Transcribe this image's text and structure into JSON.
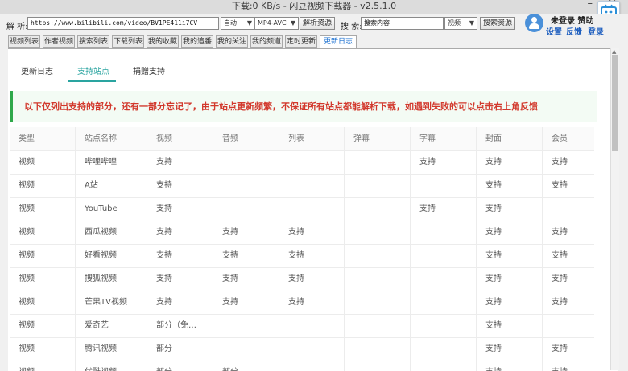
{
  "app": {
    "title": "下载:0 KB/s - 闪豆视频下载器 - v2.5.1.0",
    "minimize": "–",
    "close": "×"
  },
  "toolbar": {
    "parse_label": "解  析:",
    "url_value": "https://www.bilibili.com/video/BV1PE411i7CV",
    "quality_value": "自动",
    "format_value": "MP4-AVC",
    "parse_button": "解析资源",
    "search_label": "搜  索:",
    "search_value": "搜索内容",
    "search_type_value": "视频",
    "search_button": "搜索资源"
  },
  "user": {
    "status": "未登录 赞助",
    "settings": "设置",
    "feedback": "反馈",
    "login": "登录"
  },
  "tabs": [
    "视频列表",
    "作者视频",
    "搜索列表",
    "下载列表",
    "我的收藏",
    "我的追番",
    "我的关注",
    "我的频道",
    "定时更新",
    "更新日志"
  ],
  "subtabs": [
    "更新日志",
    "支持站点",
    "捐赠支持"
  ],
  "notice": "以下仅列出支持的部分，还有一部分忘记了，由于站点更新频繁，不保证所有站点都能解析下载，如遇到失败的可以点击右上角反馈",
  "table": {
    "columns": [
      "类型",
      "站点名称",
      "视频",
      "音频",
      "列表",
      "弹幕",
      "字幕",
      "封面",
      "会员"
    ],
    "rows": [
      [
        "视频",
        "哔哩哔哩",
        "支持",
        "",
        "",
        "",
        "支持",
        "支持",
        "支持"
      ],
      [
        "视频",
        "A站",
        "支持",
        "",
        "",
        "",
        "",
        "支持",
        "支持"
      ],
      [
        "视频",
        "YouTube",
        "支持",
        "",
        "",
        "",
        "支持",
        "支持",
        ""
      ],
      [
        "视频",
        "西瓜视频",
        "支持",
        "支持",
        "支持",
        "",
        "",
        "支持",
        "支持"
      ],
      [
        "视频",
        "好看视频",
        "支持",
        "支持",
        "支持",
        "",
        "",
        "支持",
        "支持"
      ],
      [
        "视频",
        "搜狐视频",
        "支持",
        "支持",
        "支持",
        "",
        "",
        "支持",
        "支持"
      ],
      [
        "视频",
        "芒果TV视频",
        "支持",
        "支持",
        "支持",
        "",
        "",
        "支持",
        "支持"
      ],
      [
        "视频",
        "爱奇艺",
        "部分（免…",
        "",
        "",
        "",
        "",
        "支持",
        ""
      ],
      [
        "视频",
        "腾讯视频",
        "部分",
        "",
        "",
        "",
        "",
        "支持",
        "支持"
      ],
      [
        "视频",
        "优酷视频",
        "部分",
        "部分",
        "",
        "",
        "",
        "支持",
        "支持"
      ]
    ]
  }
}
